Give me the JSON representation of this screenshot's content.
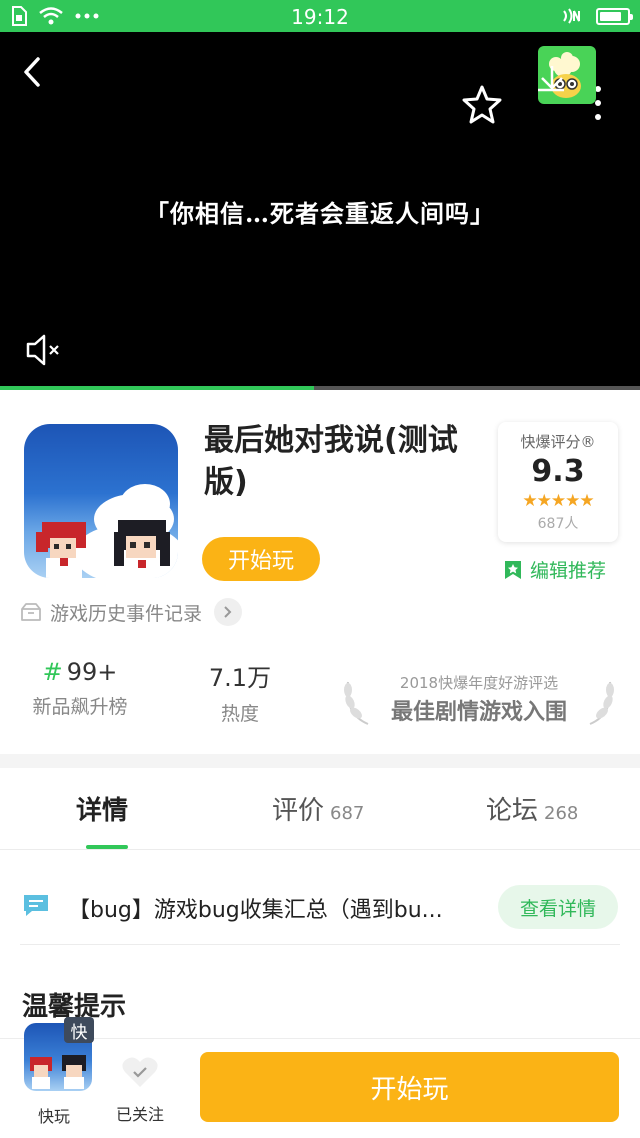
{
  "status_bar": {
    "time": "19:12",
    "battery_level": 0.8
  },
  "video": {
    "caption": "「你相信…死者会重返人间吗」",
    "progress": 0.49
  },
  "game": {
    "title": "最后她对我说(测试版)",
    "start_label": "开始玩"
  },
  "score": {
    "label": "快爆评分®",
    "value": "9.3",
    "stars": "★★★★★",
    "count": "687人"
  },
  "editor_pick": "编辑推荐",
  "history_link": "游戏历史事件记录",
  "stats": [
    {
      "value_prefix": "#",
      "value": "99+",
      "label": "新品飙升榜"
    },
    {
      "value_prefix": "",
      "value": "7.1万",
      "label": "热度"
    }
  ],
  "award": {
    "top": "2018快爆年度好游评选",
    "main": "最佳剧情游戏入围"
  },
  "tabs": [
    {
      "label": "详情",
      "count": ""
    },
    {
      "label": "评价",
      "count": "687"
    },
    {
      "label": "论坛",
      "count": "268"
    }
  ],
  "notice": {
    "text": "【bug】游戏bug收集汇总（遇到bu...",
    "button": "查看详情"
  },
  "tips_title": "温馨提示",
  "bottom_bar": {
    "quick_badge": "快",
    "quick_label": "快玩",
    "follow_label": "已关注",
    "play_label": "开始玩"
  },
  "colors": {
    "brand_green": "#31c759",
    "accent_orange": "#fbb315",
    "star_gold": "#f5a623"
  }
}
